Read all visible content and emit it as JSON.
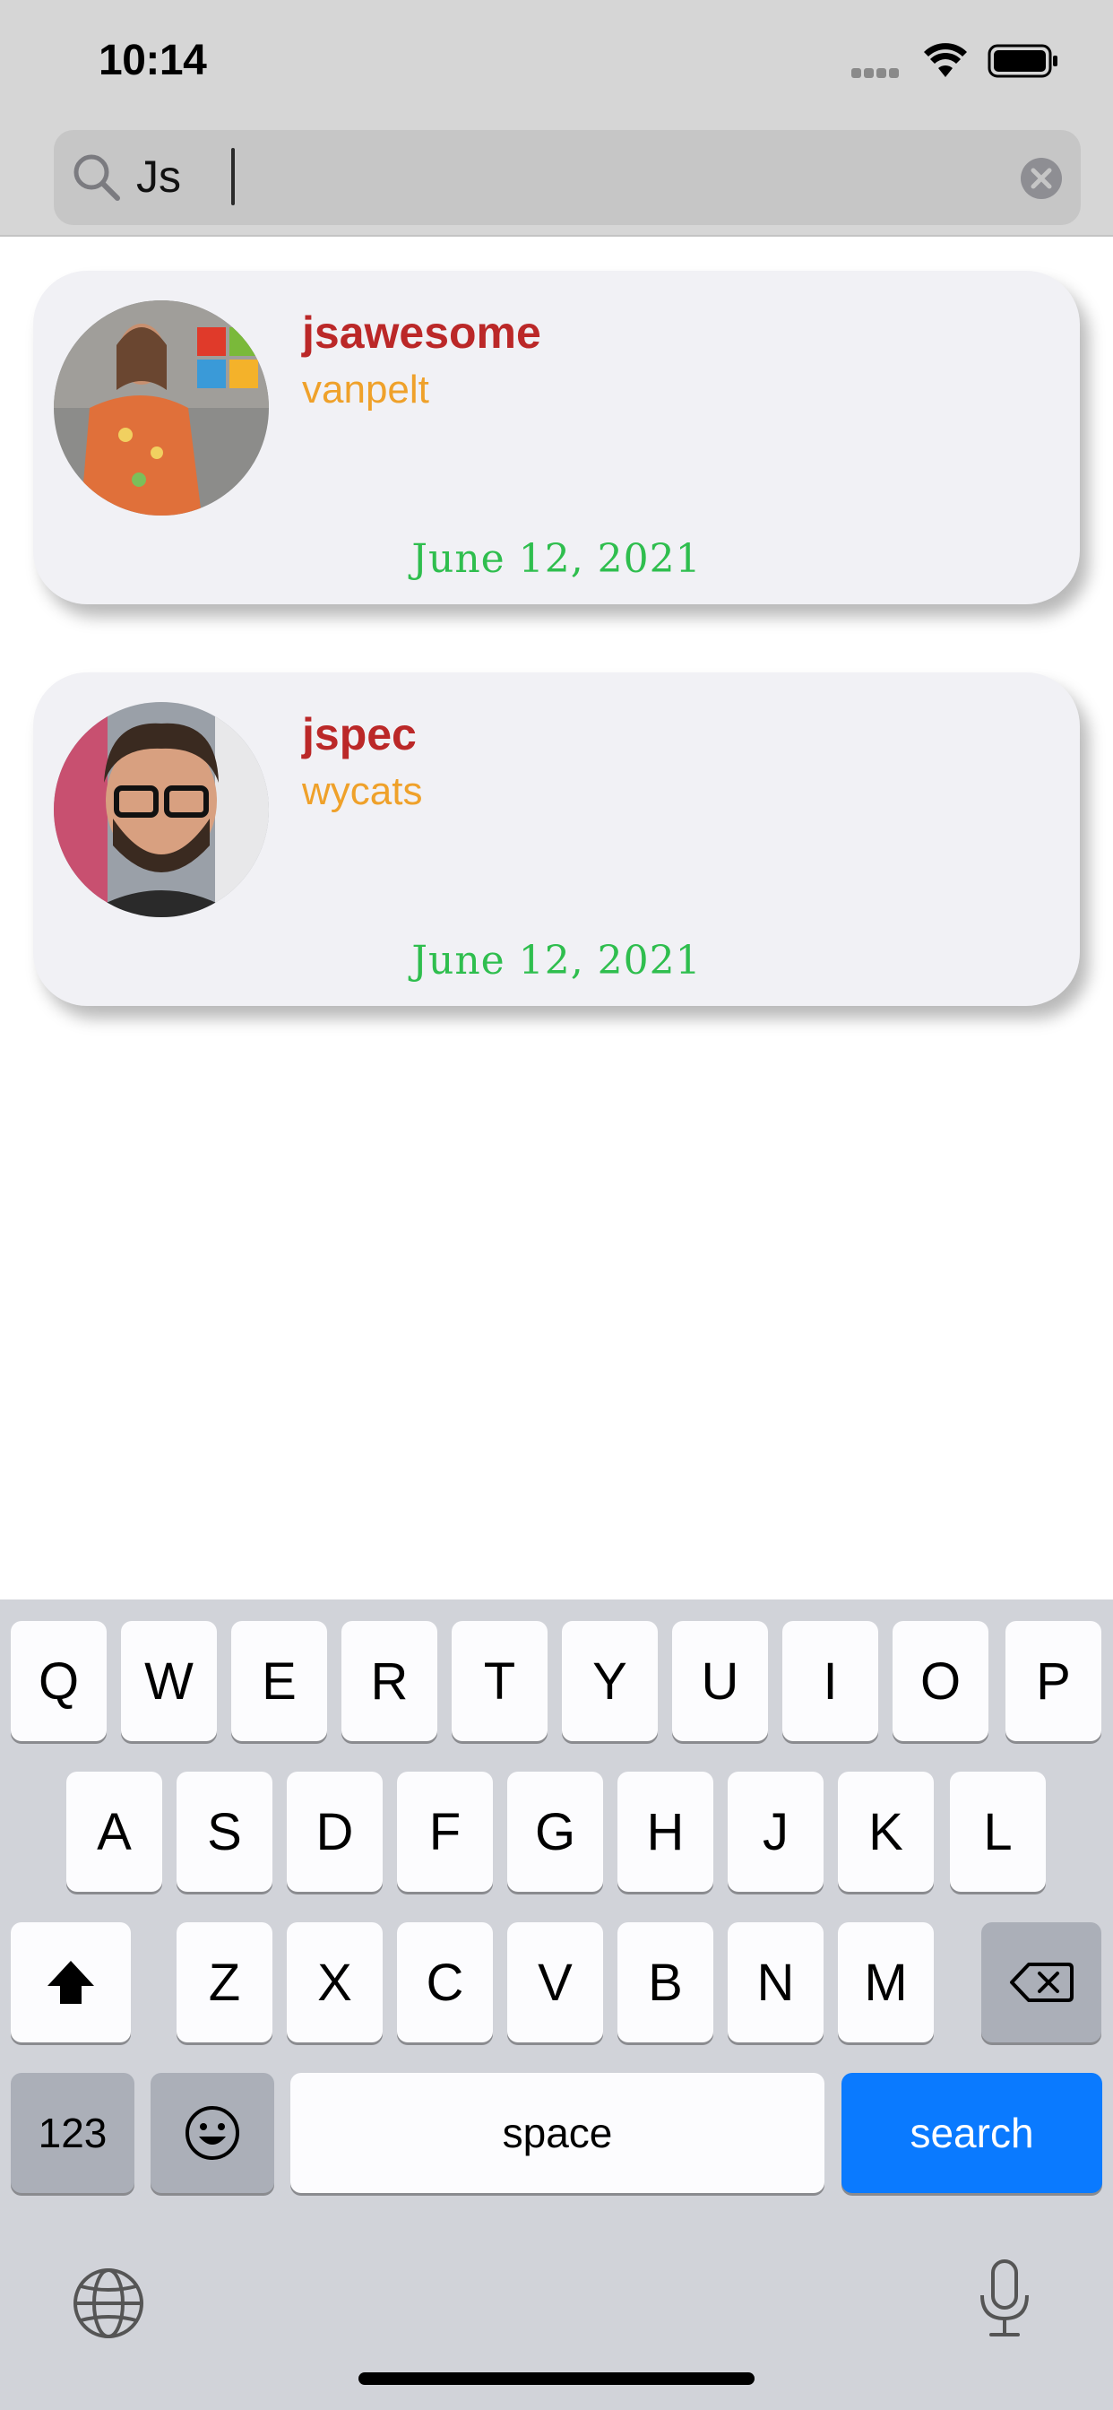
{
  "status_bar": {
    "time": "10:14"
  },
  "search": {
    "query": "Js"
  },
  "results": [
    {
      "title": "jsawesome",
      "subtitle": "vanpelt",
      "date": "June 12, 2021"
    },
    {
      "title": "jspec",
      "subtitle": "wycats",
      "date": "June 12, 2021"
    }
  ],
  "colors": {
    "title": "#bb2828",
    "subtitle": "#efa12a",
    "date": "#2fbe4e",
    "search_key": "#0a7aff"
  },
  "keyboard": {
    "row1": [
      "Q",
      "W",
      "E",
      "R",
      "T",
      "Y",
      "U",
      "I",
      "O",
      "P"
    ],
    "row2": [
      "A",
      "S",
      "D",
      "F",
      "G",
      "H",
      "J",
      "K",
      "L"
    ],
    "row3": [
      "Z",
      "X",
      "C",
      "V",
      "B",
      "N",
      "M"
    ],
    "numbers_label": "123",
    "space_label": "space",
    "search_label": "search"
  }
}
